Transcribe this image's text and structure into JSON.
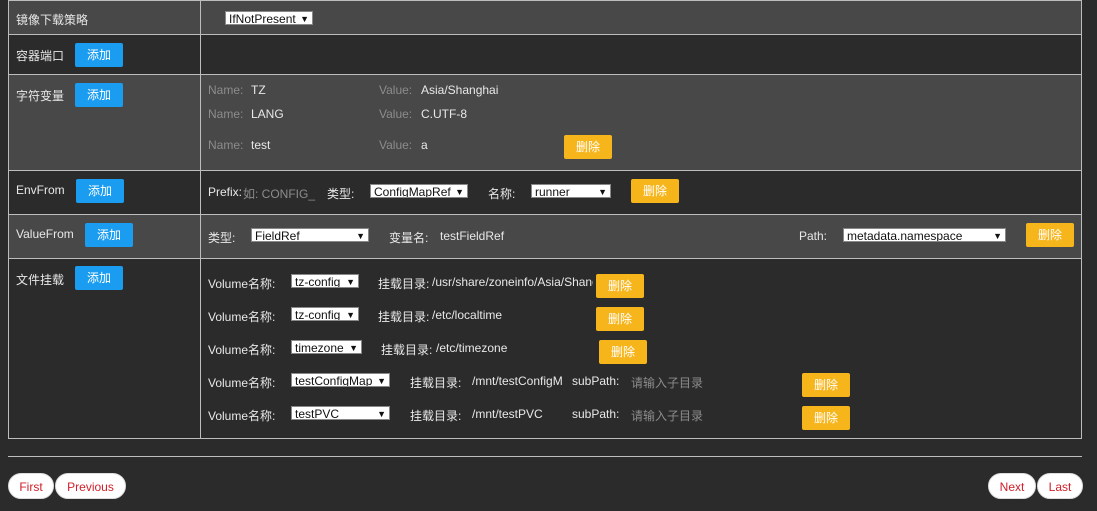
{
  "rows": {
    "pull_policy": {
      "label": "镜像下载策略",
      "value": "IfNotPresent"
    },
    "ports": {
      "label": "容器端口",
      "add": "添加"
    },
    "env": {
      "label": "字符变量",
      "add": "添加",
      "name_label": "Name:",
      "value_label": "Value:",
      "delete": "删除",
      "items": [
        {
          "name": "TZ",
          "value": "Asia/Shanghai"
        },
        {
          "name": "LANG",
          "value": "C.UTF-8"
        },
        {
          "name": "test",
          "value": "a"
        }
      ]
    },
    "envfrom": {
      "label": "EnvFrom",
      "add": "添加",
      "prefix_label": "Prefix:",
      "prefix_placeholder": "如: CONFIG_",
      "type_label": "类型:",
      "type_value": "ConfigMapRef",
      "name_label": "名称:",
      "name_value": "runner",
      "delete": "删除"
    },
    "valuefrom": {
      "label": "ValueFrom",
      "add": "添加",
      "type_label": "类型:",
      "type_value": "FieldRef",
      "var_label": "变量名:",
      "var_value": "testFieldRef",
      "path_label": "Path:",
      "path_value": "metadata.namespace",
      "delete": "删除"
    },
    "volumes": {
      "label": "文件挂载",
      "add": "添加",
      "volume_label": "Volume名称:",
      "mount_label": "挂载目录:",
      "subpath_label": "subPath:",
      "subpath_placeholder": "请输入子目录",
      "delete": "删除",
      "items": [
        {
          "volume": "tz-config",
          "mount": "/usr/share/zoneinfo/Asia/Shanghai"
        },
        {
          "volume": "tz-config",
          "mount": "/etc/localtime"
        },
        {
          "volume": "timezone",
          "mount": "/etc/timezone"
        },
        {
          "volume": "testConfigMap",
          "mount": "/mnt/testConfigMap"
        },
        {
          "volume": "testPVC",
          "mount": "/mnt/testPVC"
        }
      ]
    }
  },
  "pagination": {
    "first": "First",
    "previous": "Previous",
    "next": "Next",
    "last": "Last"
  }
}
